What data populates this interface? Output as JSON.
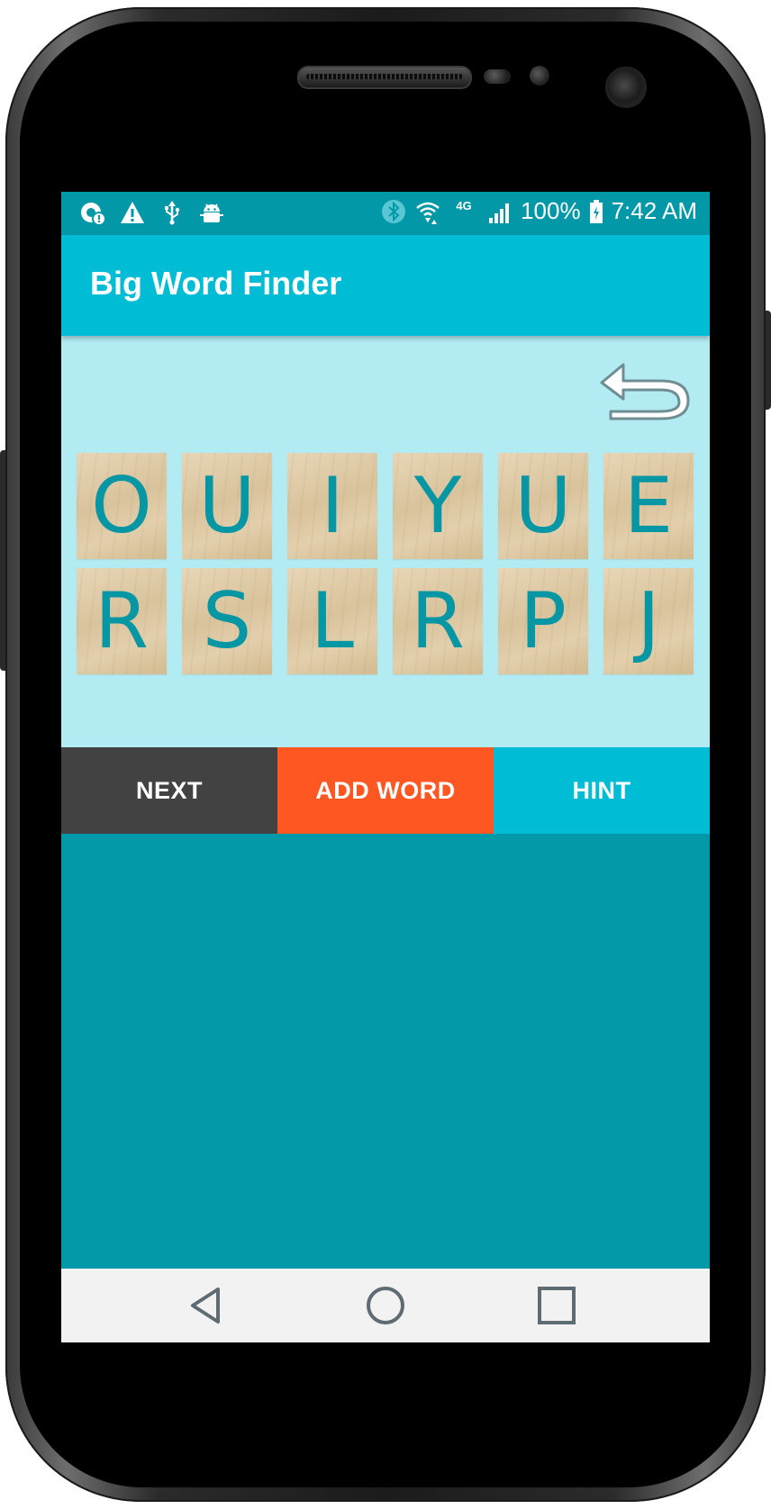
{
  "status_bar": {
    "icons_left": [
      "data-saver-icon",
      "warning-icon",
      "usb-icon",
      "android-debug-icon"
    ],
    "icons_right": [
      "bluetooth-icon",
      "wifi-icon",
      "lte-icon",
      "signal-icon",
      "battery-icon"
    ],
    "network_label": "4G",
    "battery_percent": "100%",
    "time": "7:42 AM"
  },
  "app_bar": {
    "title": "Big Word Finder"
  },
  "board": {
    "undo_icon": "undo-icon",
    "tiles": [
      {
        "letter": "O"
      },
      {
        "letter": "U"
      },
      {
        "letter": "I"
      },
      {
        "letter": "Y"
      },
      {
        "letter": "U"
      },
      {
        "letter": "E"
      },
      {
        "letter": "R"
      },
      {
        "letter": "S"
      },
      {
        "letter": "L"
      },
      {
        "letter": "R"
      },
      {
        "letter": "P"
      },
      {
        "letter": "J"
      }
    ]
  },
  "actions": {
    "next_label": "NEXT",
    "add_word_label": "ADD WORD",
    "hint_label": "HINT"
  },
  "nav_bar": {
    "back_icon": "back-icon",
    "home_icon": "home-icon",
    "recents_icon": "recents-icon"
  },
  "colors": {
    "primary": "#00bcd4",
    "primary_dark": "#0398a8",
    "board_bg": "#b2ebf2",
    "accent": "#ff5722",
    "next_button": "#424242",
    "tile_letter": "#0796a4"
  }
}
